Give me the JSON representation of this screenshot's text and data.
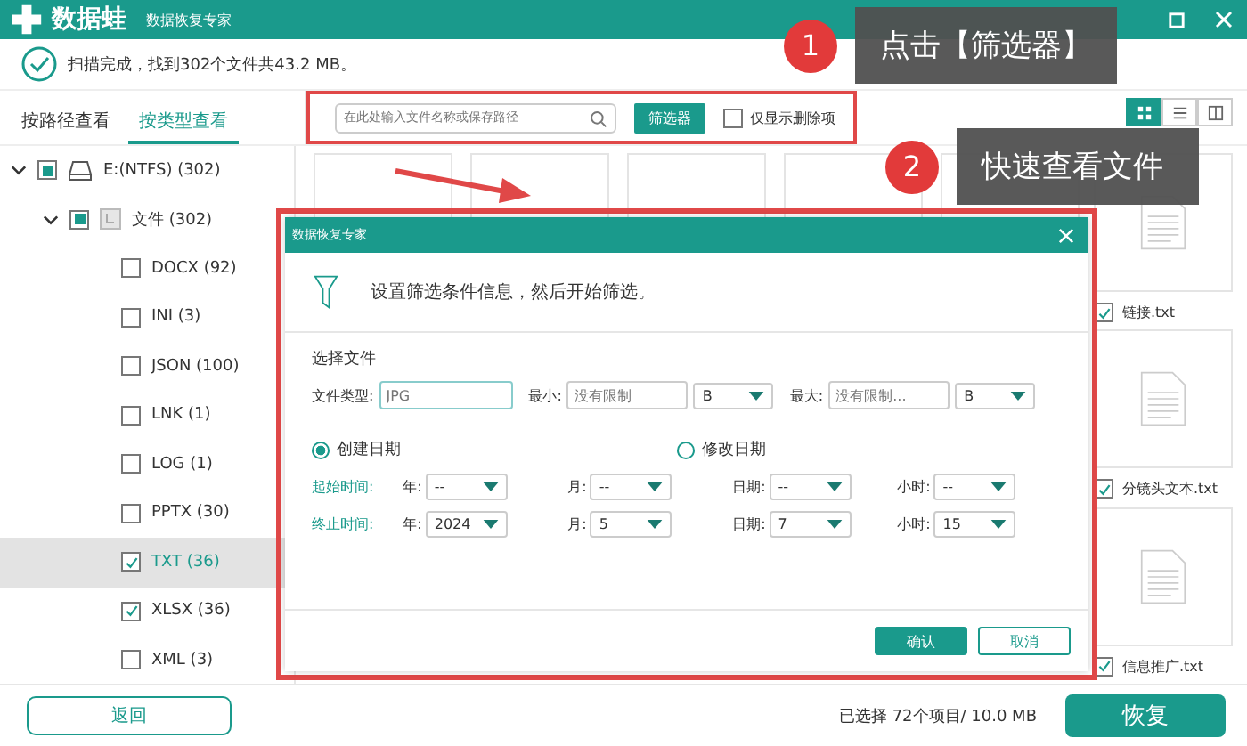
{
  "title_bar": {
    "logo": "数据蛙",
    "subtitle": "数据恢复专家"
  },
  "scan_status": "扫描完成，找到302个文件共43.2 MB。",
  "tabs": [
    {
      "label": "按路径查看",
      "selected": false
    },
    {
      "label": "按类型查看",
      "selected": true
    }
  ],
  "toolbar": {
    "search": {
      "placeholder": "在此处输入文件名称或保存路径"
    },
    "filter_button": "筛选器",
    "deleted_only": {
      "label": "仅显示删除项",
      "checked": false
    }
  },
  "view_modes": [
    {
      "kind": "grid",
      "selected": true
    },
    {
      "kind": "list",
      "selected": false
    },
    {
      "kind": "detail",
      "selected": false
    }
  ],
  "tree": [
    {
      "label": "E:(NTFS) (302)",
      "kind": "drive",
      "partial": true,
      "expanded": true,
      "selected": false,
      "children": [
        {
          "label": "文件 (302)",
          "kind": "folder",
          "partial": true,
          "expanded": true,
          "selected": false,
          "children": [
            {
              "label": "DOCX (92)",
              "checked": false,
              "selected": false
            },
            {
              "label": "INI (3)",
              "checked": false,
              "selected": false
            },
            {
              "label": "JSON (100)",
              "checked": false,
              "selected": false
            },
            {
              "label": "LNK (1)",
              "checked": false,
              "selected": false
            },
            {
              "label": "LOG (1)",
              "checked": false,
              "selected": false
            },
            {
              "label": "PPTX (30)",
              "checked": false,
              "selected": false
            },
            {
              "label": "TXT (36)",
              "checked": true,
              "selected": true
            },
            {
              "label": "XLSX (36)",
              "checked": true,
              "selected": false
            },
            {
              "label": "XML (3)",
              "checked": false,
              "selected": false
            }
          ]
        }
      ]
    }
  ],
  "files": [
    {
      "name": "链接.txt",
      "checked": true
    },
    {
      "name": "分镜头文本.txt",
      "checked": true
    },
    {
      "name": "信息推广.txt",
      "checked": true
    }
  ],
  "dialog": {
    "title": "数据恢复专家",
    "intro": "设置筛选条件信息，然后开始筛选。",
    "section": "选择文件",
    "type_label": "文件类型:",
    "type_placeholder": "JPG",
    "min_label": "最小:",
    "min_placeholder": "没有限制",
    "min_unit": "B",
    "max_label": "最大:",
    "max_placeholder": "没有限制...",
    "max_unit": "B",
    "date_modes": [
      {
        "label": "创建日期",
        "selected": true
      },
      {
        "label": "修改日期",
        "selected": false
      }
    ],
    "ranges": [
      {
        "label": "起始时间:",
        "fields": [
          {
            "label": "年:",
            "value": "--"
          },
          {
            "label": "月:",
            "value": "--"
          },
          {
            "label": "日期:",
            "value": "--"
          },
          {
            "label": "小时:",
            "value": "--"
          }
        ]
      },
      {
        "label": "终止时间:",
        "fields": [
          {
            "label": "年:",
            "value": "2024"
          },
          {
            "label": "月:",
            "value": "5"
          },
          {
            "label": "日期:",
            "value": "7"
          },
          {
            "label": "小时:",
            "value": "15"
          }
        ]
      }
    ],
    "buttons": [
      {
        "label": "确认",
        "kind": "primary"
      },
      {
        "label": "取消",
        "kind": "secondary"
      }
    ]
  },
  "callouts": [
    {
      "number": "1",
      "text": "点击【筛选器】"
    },
    {
      "number": "2",
      "text": "快速查看文件"
    }
  ],
  "footer": {
    "back_button": "返回",
    "selection": "已选择 72个项目/ 10.0 MB",
    "recover_button": "恢复"
  }
}
